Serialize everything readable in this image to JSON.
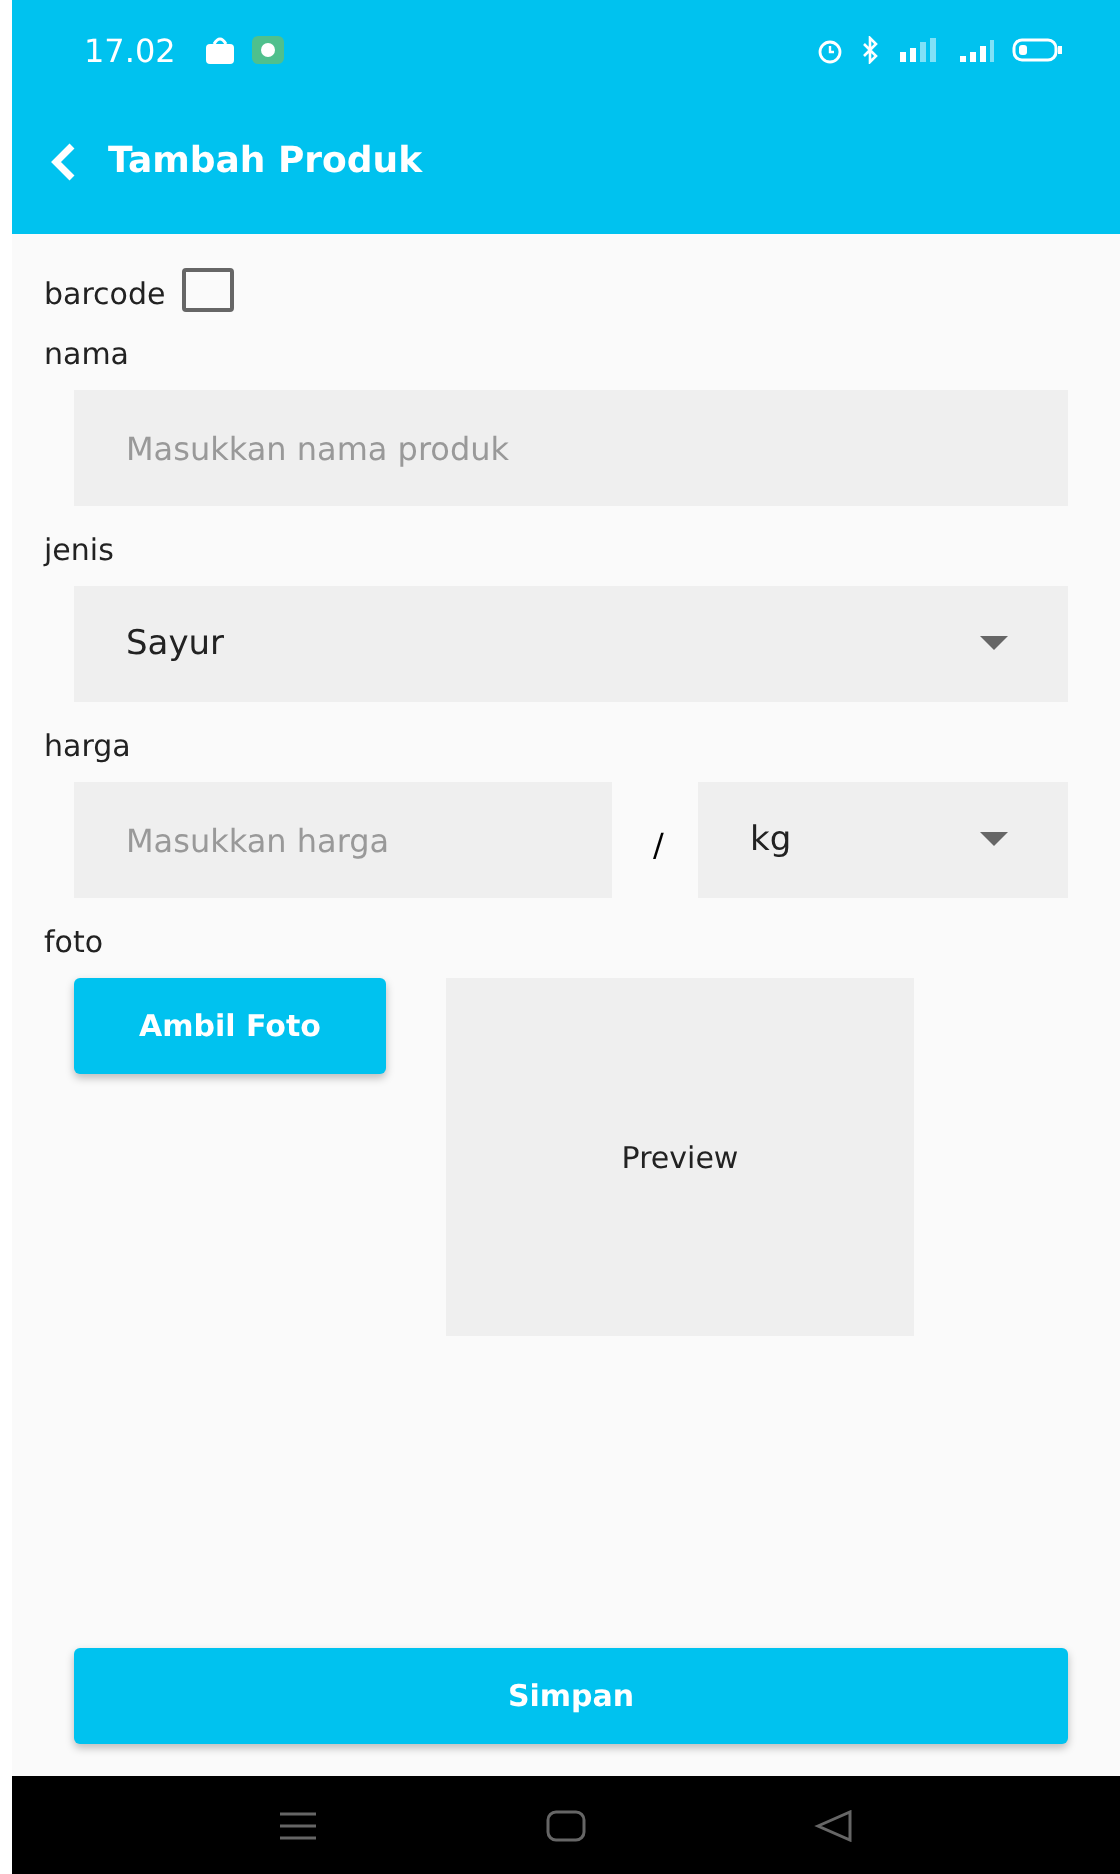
{
  "status_bar": {
    "time": "17.02"
  },
  "app_bar": {
    "title": "Tambah Produk"
  },
  "barcode": {
    "label": "barcode",
    "checked": false
  },
  "nama": {
    "label": "nama",
    "placeholder": "Masukkan nama produk"
  },
  "jenis": {
    "label": "jenis",
    "value": "Sayur"
  },
  "harga": {
    "label": "harga",
    "placeholder": "Masukkan harga",
    "separator": "/",
    "unit": "kg"
  },
  "foto": {
    "label": "foto",
    "button": "Ambil Foto",
    "preview": "Preview"
  },
  "save_button": "Simpan"
}
